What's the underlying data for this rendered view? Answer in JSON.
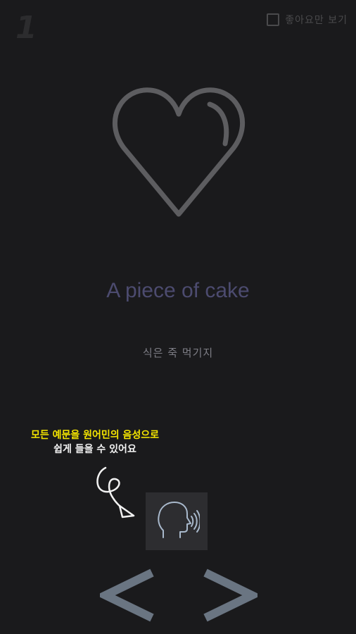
{
  "header": {
    "page_number": "1",
    "favorites_only_label": "좋아요만 보기",
    "favorites_only_checked": false
  },
  "card": {
    "icon": "heart-icon",
    "phrase": "A piece of cake",
    "translation": "식은 죽 먹기지"
  },
  "tip": {
    "line1": "모든 예문을 원어민의 음성으로",
    "line2": "쉽게 들을 수 있어요"
  },
  "controls": {
    "speak_icon": "speaking-head-icon",
    "prev_icon": "chevron-left-icon",
    "next_icon": "chevron-right-icon"
  },
  "colors": {
    "background": "#1a1a1c",
    "heart_stroke": "#5d5d60",
    "phrase": "#4c4b6f",
    "nav_arrow": "#6a7582",
    "tip_highlight": "#f5e600"
  }
}
